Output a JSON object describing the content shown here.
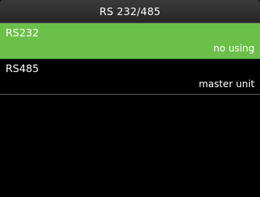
{
  "window": {
    "title": "RS 232/485"
  },
  "menu": {
    "items": [
      {
        "label": "RS232",
        "value": "no using",
        "selected": true
      },
      {
        "label": "RS485",
        "value": "master unit",
        "selected": false
      }
    ]
  },
  "colors": {
    "selected_background": "#6cc04a",
    "background": "#000000",
    "text": "#ffffff"
  }
}
